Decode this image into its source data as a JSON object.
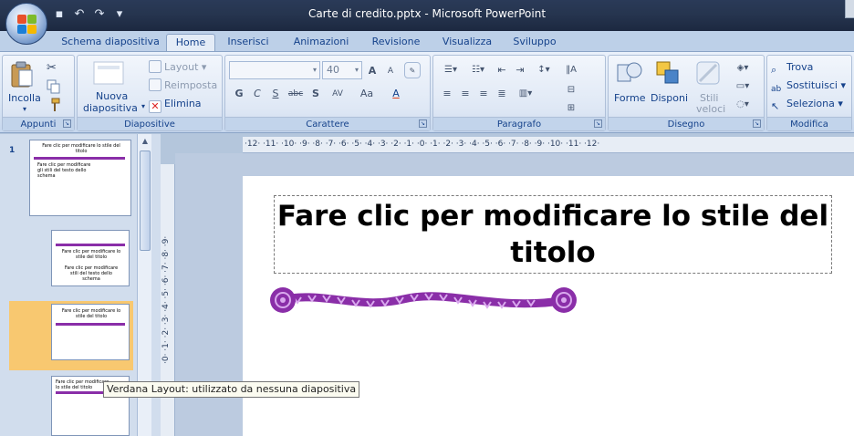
{
  "window": {
    "title": "Carte di credito.pptx - Microsoft PowerPoint"
  },
  "qat": {
    "save_icon": "save-icon",
    "undo_icon": "undo-icon",
    "redo_icon": "redo-icon",
    "customize_icon": "customize-icon"
  },
  "tabs": [
    {
      "label": "Schema diapositiva"
    },
    {
      "label": "Home"
    },
    {
      "label": "Inserisci"
    },
    {
      "label": "Animazioni"
    },
    {
      "label": "Revisione"
    },
    {
      "label": "Visualizza"
    },
    {
      "label": "Sviluppo"
    }
  ],
  "ribbon": {
    "clipboard": {
      "label": "Appunti",
      "paste": "Incolla"
    },
    "slides": {
      "label": "Diapositive",
      "new_slide_1": "Nuova",
      "new_slide_2": "diapositiva",
      "layout": "Layout",
      "reset": "Reimposta",
      "delete": "Elimina"
    },
    "font": {
      "label": "Carattere",
      "font_name": "",
      "font_size": "40",
      "bold": "G",
      "italic": "C",
      "underline": "S",
      "shadow": "S",
      "strike": "abc",
      "spacing": "AV",
      "case": "Aa",
      "grow": "A",
      "shrink": "A"
    },
    "paragraph": {
      "label": "Paragrafo"
    },
    "drawing": {
      "label": "Disegno",
      "shapes": "Forme",
      "arrange": "Disponi",
      "styles_1": "Stili",
      "styles_2": "veloci"
    },
    "editing": {
      "label": "Modifica",
      "find": "Trova",
      "replace": "Sostituisci",
      "select": "Seleziona"
    }
  },
  "thumbnails": [
    {
      "number": "1",
      "title": "Fare clic per modificare lo stile del titolo",
      "body": "Fare clic per modificare gli stili del testo dello schema"
    },
    {
      "number": "",
      "title": "Fare clic per modificare lo stile del titolo",
      "body": "Fare clic per modificare stili del testo dello schema"
    },
    {
      "number": "",
      "title": "Fare clic per modificare lo stile del titolo",
      "body": ""
    },
    {
      "number": "",
      "title": "Fare clic per modificare lo stile del titolo",
      "body": ""
    }
  ],
  "ruler": {
    "horizontal": "·12· ·11· ·10· ·9· ·8· ·7· ·6· ·5· ·4· ·3· ·2· ·1· ·0· ·1· ·2· ·3· ·4· ·5· ·6· ·7· ·8· ·9· ·10· ·11· ·12·",
    "vertical": "·0· ·1· ·2· ·3· ·4· ·5· ·6· ·7· ·8· ·9·"
  },
  "slide": {
    "title": "Fare clic per modificare lo stile del titolo"
  },
  "tooltip": {
    "text": "Verdana Layout: utilizzato da nessuna diapositiva"
  },
  "colors": {
    "accent_purple": "#8a2ea8",
    "selection": "#f8c870",
    "ribbon_text": "#15428b"
  }
}
